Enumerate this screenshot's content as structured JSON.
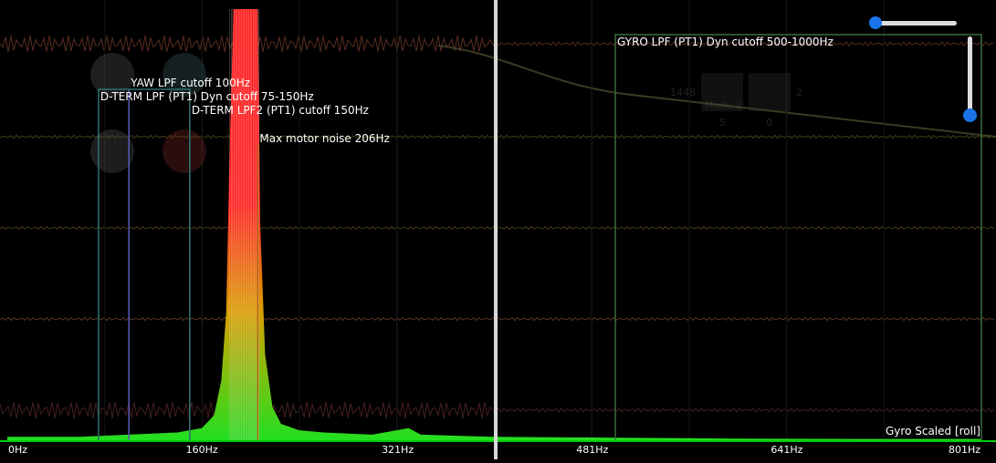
{
  "chart_data": {
    "type": "area",
    "xlabel": "",
    "ylabel": "",
    "xlim": [
      0,
      801
    ],
    "x_ticks": [
      "0Hz",
      "160Hz",
      "321Hz",
      "481Hz",
      "641Hz",
      "801Hz"
    ],
    "x_tick_values": [
      0,
      160,
      321,
      481,
      641,
      801
    ],
    "legend_label": "Gyro Scaled [roll]",
    "spectrum": {
      "peak_range_hz": [
        183,
        207
      ],
      "points": [
        [
          0,
          0.01
        ],
        [
          60,
          0.01
        ],
        [
          100,
          0.015
        ],
        [
          140,
          0.02
        ],
        [
          160,
          0.03
        ],
        [
          170,
          0.06
        ],
        [
          176,
          0.14
        ],
        [
          180,
          0.3
        ],
        [
          183,
          0.7
        ],
        [
          186,
          1.2
        ],
        [
          190,
          1.6
        ],
        [
          196,
          1.6
        ],
        [
          202,
          1.5
        ],
        [
          206,
          1.1
        ],
        [
          208,
          0.5
        ],
        [
          212,
          0.2
        ],
        [
          218,
          0.08
        ],
        [
          225,
          0.04
        ],
        [
          240,
          0.025
        ],
        [
          260,
          0.02
        ],
        [
          300,
          0.015
        ],
        [
          330,
          0.03
        ],
        [
          340,
          0.015
        ],
        [
          400,
          0.01
        ],
        [
          500,
          0.008
        ],
        [
          600,
          0.006
        ],
        [
          700,
          0.005
        ],
        [
          801,
          0.005
        ]
      ]
    },
    "filter_markers": [
      {
        "label": "YAW LPF cutoff 100Hz",
        "hz": 100,
        "color": "#5a5ab8"
      },
      {
        "label": "D-TERM LPF (PT1) Dyn cutoff 75-150Hz",
        "hz_range": [
          75,
          150
        ],
        "color": "#2f6f6f"
      },
      {
        "label": "D-TERM LPF2 (PT1) cutoff 150Hz",
        "hz": 150,
        "color": "#2f6f6f"
      },
      {
        "label": "Max motor noise 206Hz",
        "hz": 206,
        "color": "#b5651d"
      },
      {
        "label": "GYRO LPF (PT1) Dyn cutoff 500-1000Hz",
        "hz_range": [
          500,
          1000
        ],
        "color": "#3a6b3a"
      }
    ],
    "background_overlay": {
      "stick_readouts": [
        "1448",
        "2",
        "5",
        "0"
      ],
      "mode_label": "Mode 2"
    },
    "colors": {
      "spectrum_top": "#ff0000",
      "spectrum_bottom": "#00e000",
      "baseline": "#00cc00"
    }
  }
}
